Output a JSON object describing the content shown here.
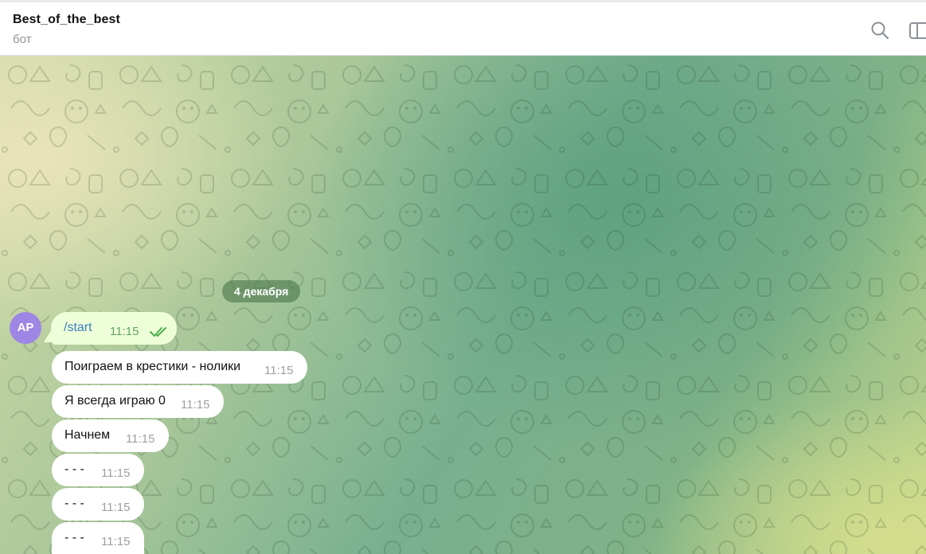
{
  "header": {
    "title": "Best_of_the_best",
    "status": "бот",
    "search_icon": "search-icon",
    "panel_icon": "sidebar-panel-icon"
  },
  "chat": {
    "date_separator": "4 декабря",
    "avatar_initials": "AP",
    "avatar_color": "#9d86e4",
    "messages": [
      {
        "direction": "outgoing",
        "text": "/start",
        "time": "11:15",
        "read": true
      },
      {
        "direction": "incoming",
        "text": "Поиграем в крестики - нолики",
        "time": "11:15"
      },
      {
        "direction": "incoming",
        "text": "Я всегда играю 0",
        "time": "11:15"
      },
      {
        "direction": "incoming",
        "text": "Начнем",
        "time": "11:15"
      },
      {
        "direction": "incoming",
        "text": "- - -",
        "time": "11:15"
      },
      {
        "direction": "incoming",
        "text": "- - -",
        "time": "11:15"
      },
      {
        "direction": "incoming",
        "text": "- - -",
        "time": "11:15"
      }
    ]
  },
  "colors": {
    "outgoing_bubble": "#eefed8",
    "incoming_bubble": "#ffffff",
    "command_link": "#3b7fc4",
    "read_check": "#4fae4e"
  }
}
